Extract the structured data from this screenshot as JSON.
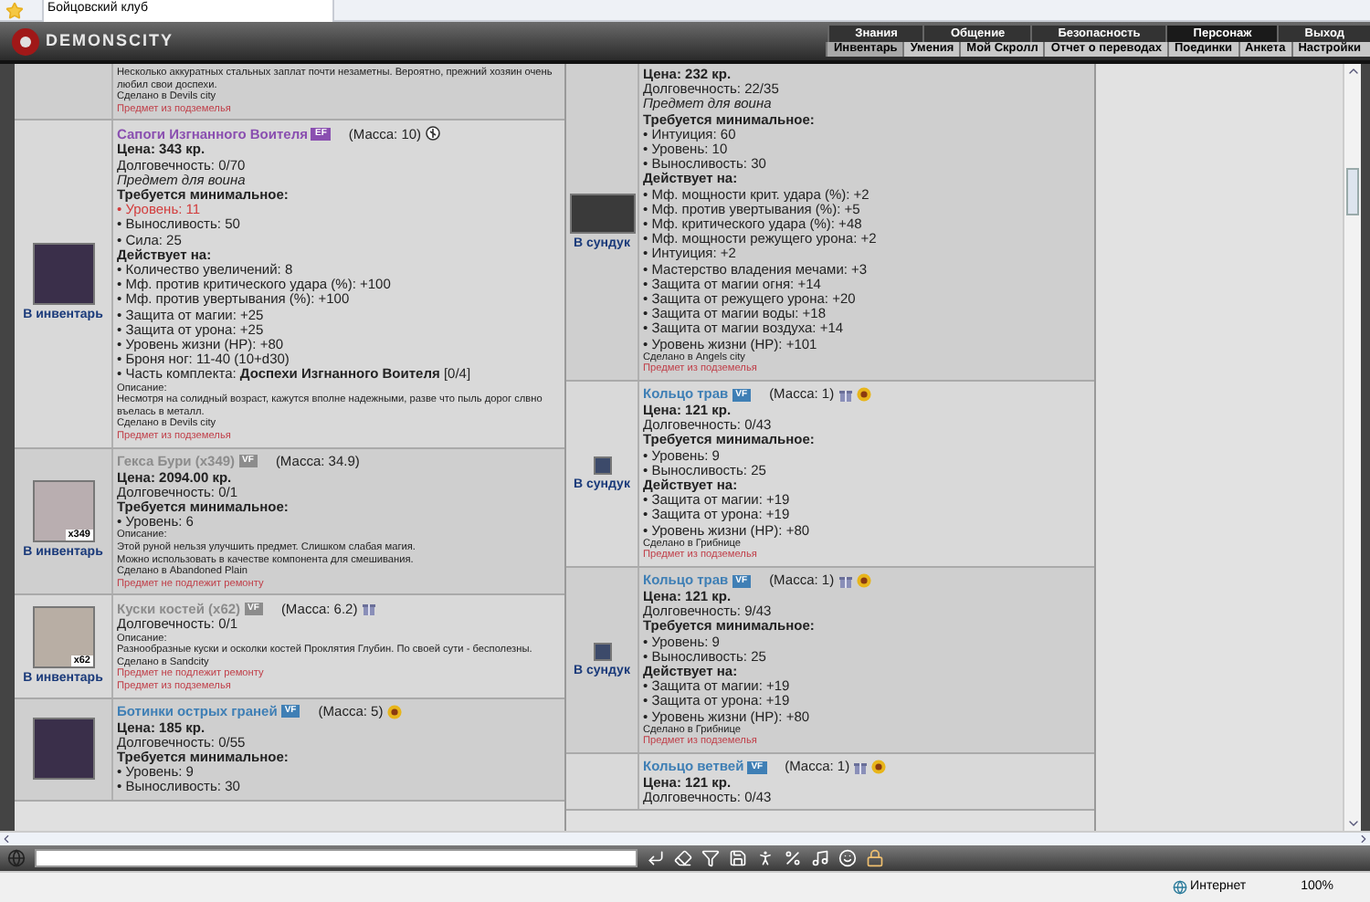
{
  "browser_tab": {
    "title": "Бойцовский клуб"
  },
  "header": {
    "logo": "DEMONSCITY",
    "top_menu": [
      {
        "label": "Знания",
        "selected": false
      },
      {
        "label": "Общение",
        "selected": false
      },
      {
        "label": "Безопасность",
        "selected": false
      },
      {
        "label": "Персонаж",
        "selected": true
      },
      {
        "label": "Выход",
        "selected": false
      }
    ],
    "sub_menu": [
      {
        "label": "Инвентарь",
        "selected": true
      },
      {
        "label": "Умения",
        "selected": false
      },
      {
        "label": "Мой Скролл",
        "selected": false
      },
      {
        "label": "Отчет о переводах",
        "selected": false
      },
      {
        "label": "Поединки",
        "selected": false
      },
      {
        "label": "Анкета",
        "selected": false
      },
      {
        "label": "Настройки",
        "selected": false
      }
    ]
  },
  "left_items": [
    {
      "lines": [
        {
          "kind": "small",
          "text": "Несколько аккуратных стальных заплат почти незаметны. Вероятно, прежний хозяин очень любил свои доспехи."
        },
        {
          "kind": "small",
          "text": "Сделано в Devils city"
        },
        {
          "kind": "notice",
          "text": "Предмет из подземелья"
        }
      ]
    },
    {
      "name": "Сапоги Изгнанного Воителя",
      "color": "#8a4fb0",
      "badge": "EF",
      "mass": "(Масса: 10)",
      "icons": [
        {
          "kind": "rune"
        }
      ],
      "link": "В инвентарь",
      "kind": "boots",
      "lines": [
        {
          "kind": "price",
          "text": "Цена: 343 кр."
        },
        {
          "kind": "text",
          "text": "Долговечность: 0/70"
        },
        {
          "kind": "italic",
          "text": "Предмет для воина"
        },
        {
          "kind": "heading",
          "text": "Требуется минимальное:"
        },
        {
          "kind": "warn",
          "text": "• Уровень: 11"
        },
        {
          "kind": "text",
          "text": "• Выносливость: 50"
        },
        {
          "kind": "text",
          "text": "• Сила: 25"
        },
        {
          "kind": "heading",
          "text": "Действует на:"
        },
        {
          "kind": "text",
          "text": "• Количество увеличений: 8"
        },
        {
          "kind": "text",
          "text": "• Мф. против критического удара (%): +100"
        },
        {
          "kind": "text",
          "text": "• Мф. против увертывания (%): +100"
        },
        {
          "kind": "text",
          "text": "• Защита от магии: +25"
        },
        {
          "kind": "text",
          "text": "• Защита от урона: +25"
        },
        {
          "kind": "text",
          "text": "• Уровень жизни (HP): +80"
        },
        {
          "kind": "text",
          "text": "• Броня ног: 11-40 (10+d30)"
        },
        {
          "kind": "text",
          "text": "• Часть комплекта: **Доспехи Изгнанного Воителя** [0/4]"
        },
        {
          "kind": "small",
          "text": "Описание:"
        },
        {
          "kind": "small",
          "text": "Несмотря на солидный возраст, кажутся вполне надежными, разве что пыль дорог слвно въелась в металл."
        },
        {
          "kind": "small",
          "text": "Сделано в Devils city"
        },
        {
          "kind": "notice",
          "text": "Предмет из подземелья"
        }
      ]
    },
    {
      "name": "Гекса Бури (x349)",
      "color": "#8c8c8c",
      "badge": "VF",
      "mass": "(Масса: 34.9)",
      "link": "В инвентарь",
      "kind": "rune",
      "count": "x349",
      "lines": [
        {
          "kind": "price",
          "text": "Цена: 2094.00 кр."
        },
        {
          "kind": "text",
          "text": "Долговечность: 0/1"
        },
        {
          "kind": "heading",
          "text": "Требуется минимальное:"
        },
        {
          "kind": "text",
          "text": "• Уровень: 6"
        },
        {
          "kind": "small",
          "text": "Описание:"
        },
        {
          "kind": "small",
          "text": "Этой руной нельзя улучшить предмет. Слишком слабая магия."
        },
        {
          "kind": "small",
          "text": "Можно использовать в качестве компонента для смешивания."
        },
        {
          "kind": "small",
          "text": "Сделано в Abandoned Plain"
        },
        {
          "kind": "notice",
          "text": "Предмет не подлежит ремонту"
        }
      ]
    },
    {
      "name": "Куски костей (x62)",
      "color": "#8c8c8c",
      "badge": "VF",
      "mass": "(Масса: 6.2)",
      "icons": [
        {
          "kind": "gift"
        }
      ],
      "link": "В инвентарь",
      "kind": "bone",
      "count": "x62",
      "lines": [
        {
          "kind": "text",
          "text": "Долговечность: 0/1"
        },
        {
          "kind": "small",
          "text": "Описание:"
        },
        {
          "kind": "small",
          "text": "Разнообразные куски и осколки костей Проклятия Глубин. По своей сути - бесполезны."
        },
        {
          "kind": "small",
          "text": "Сделано в Sandcity"
        },
        {
          "kind": "notice",
          "text": "Предмет не подлежит ремонту"
        },
        {
          "kind": "notice",
          "text": "Предмет из подземелья"
        }
      ]
    },
    {
      "name": "Ботинки острых граней",
      "color": "#3f7fb5",
      "badge": "VF",
      "mass": "(Масса: 5)",
      "icons": [
        {
          "kind": "medal"
        }
      ],
      "kind": "boots",
      "lines": [
        {
          "kind": "price",
          "text": "Цена: 185 кр."
        },
        {
          "kind": "text",
          "text": "Долговечность: 0/55"
        },
        {
          "kind": "heading",
          "text": "Требуется минимальное:"
        },
        {
          "kind": "text",
          "text": "• Уровень: 9"
        },
        {
          "kind": "text",
          "text": "• Выносливость: 30"
        }
      ]
    }
  ],
  "right_items": [
    {
      "link": "В сундук",
      "kind": "chain",
      "lines": [
        {
          "kind": "price",
          "text": "Цена: 232 кр."
        },
        {
          "kind": "text",
          "text": "Долговечность: 22/35"
        },
        {
          "kind": "italic",
          "text": "Предмет для воина"
        },
        {
          "kind": "heading",
          "text": "Требуется минимальное:"
        },
        {
          "kind": "text",
          "text": "• Интуиция: 60"
        },
        {
          "kind": "text",
          "text": "• Уровень: 10"
        },
        {
          "kind": "text",
          "text": "• Выносливость: 30"
        },
        {
          "kind": "heading",
          "text": "Действует на:"
        },
        {
          "kind": "text",
          "text": "• Мф. мощности крит. удара (%): +2"
        },
        {
          "kind": "text",
          "text": "• Мф. против увертывания (%): +5"
        },
        {
          "kind": "text",
          "text": "• Мф. критического удара (%): +48"
        },
        {
          "kind": "text",
          "text": "• Мф. мощности режущего урона: +2"
        },
        {
          "kind": "text",
          "text": "• Интуиция: +2"
        },
        {
          "kind": "text",
          "text": "• Мастерство владения мечами: +3"
        },
        {
          "kind": "text",
          "text": "• Защита от магии огня: +14"
        },
        {
          "kind": "text",
          "text": "• Защита от режущего урона: +20"
        },
        {
          "kind": "text",
          "text": "• Защита от магии воды: +18"
        },
        {
          "kind": "text",
          "text": "• Защита от магии воздуха: +14"
        },
        {
          "kind": "text",
          "text": "• Уровень жизни (HP): +101"
        },
        {
          "kind": "small",
          "text": "Сделано в Angels city"
        },
        {
          "kind": "notice",
          "text": "Предмет из подземелья"
        }
      ]
    },
    {
      "name": "Кольцо трав",
      "color": "#3f7fb5",
      "badge": "VF",
      "mass": "(Масса: 1)",
      "icons": [
        {
          "kind": "gift"
        },
        {
          "kind": "medal"
        }
      ],
      "link": "В сундук",
      "kind": "ring",
      "lines": [
        {
          "kind": "price",
          "text": "Цена: 121 кр."
        },
        {
          "kind": "text",
          "text": "Долговечность: 0/43"
        },
        {
          "kind": "heading",
          "text": "Требуется минимальное:"
        },
        {
          "kind": "text",
          "text": "• Уровень: 9"
        },
        {
          "kind": "text",
          "text": "• Выносливость: 25"
        },
        {
          "kind": "heading",
          "text": "Действует на:"
        },
        {
          "kind": "text",
          "text": "• Защита от магии: +19"
        },
        {
          "kind": "text",
          "text": "• Защита от урона: +19"
        },
        {
          "kind": "text",
          "text": "• Уровень жизни (HP): +80"
        },
        {
          "kind": "small",
          "text": "Сделано в Грибнице"
        },
        {
          "kind": "notice",
          "text": "Предмет из подземелья"
        }
      ]
    },
    {
      "name": "Кольцо трав",
      "color": "#3f7fb5",
      "badge": "VF",
      "mass": "(Масса: 1)",
      "icons": [
        {
          "kind": "gift"
        },
        {
          "kind": "medal"
        }
      ],
      "link": "В сундук",
      "kind": "ring",
      "lines": [
        {
          "kind": "price",
          "text": "Цена: 121 кр."
        },
        {
          "kind": "text",
          "text": "Долговечность: 9/43"
        },
        {
          "kind": "heading",
          "text": "Требуется минимальное:"
        },
        {
          "kind": "text",
          "text": "• Уровень: 9"
        },
        {
          "kind": "text",
          "text": "• Выносливость: 25"
        },
        {
          "kind": "heading",
          "text": "Действует на:"
        },
        {
          "kind": "text",
          "text": "• Защита от магии: +19"
        },
        {
          "kind": "text",
          "text": "• Защита от урона: +19"
        },
        {
          "kind": "text",
          "text": "• Уровень жизни (HP): +80"
        },
        {
          "kind": "small",
          "text": "Сделано в Грибнице"
        },
        {
          "kind": "notice",
          "text": "Предмет из подземелья"
        }
      ]
    },
    {
      "name": "Кольцо ветвей",
      "color": "#3f7fb5",
      "badge": "VF",
      "mass": "(Масса: 1)",
      "icons": [
        {
          "kind": "gift"
        },
        {
          "kind": "medal"
        }
      ],
      "lines": [
        {
          "kind": "price",
          "text": "Цена: 121 кр."
        },
        {
          "kind": "text",
          "text": "Долговечность: 0/43"
        }
      ]
    }
  ],
  "status_bar": {
    "zone": "Интернет",
    "zoom": "100%"
  }
}
